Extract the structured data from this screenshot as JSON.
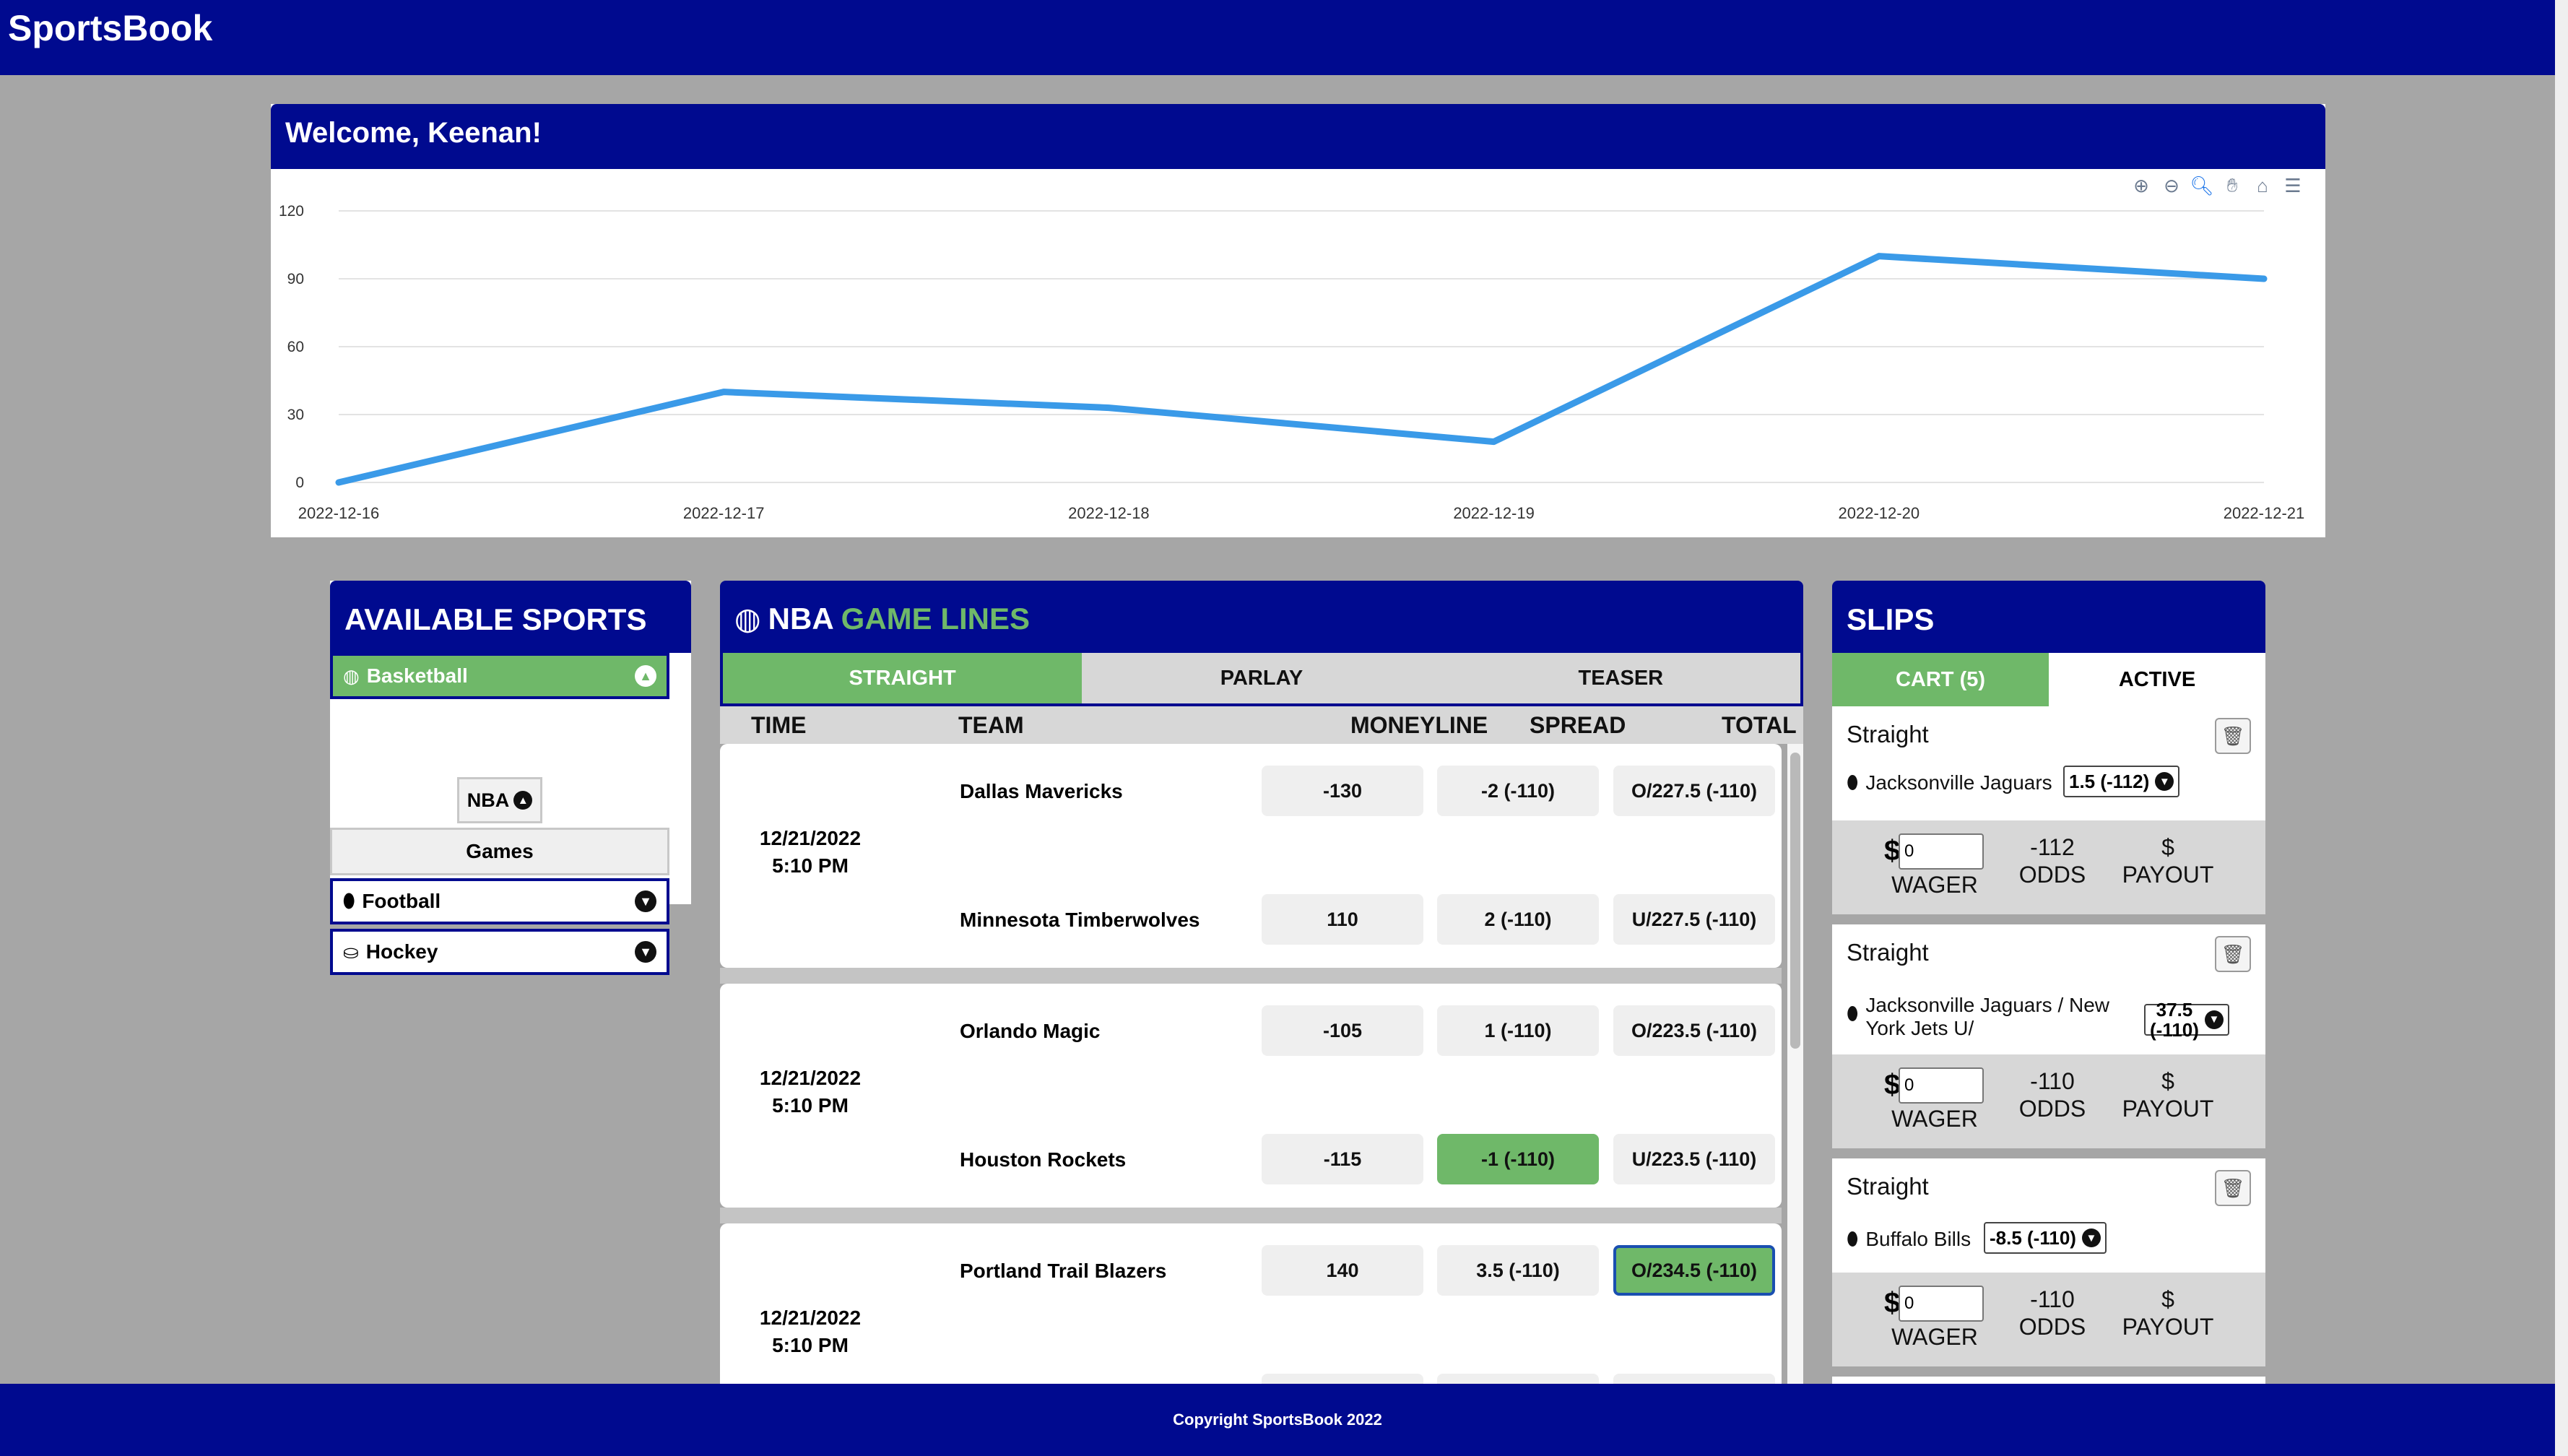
{
  "app": {
    "brand": "SportsBook"
  },
  "welcome": {
    "title": "Welcome, Keenan!"
  },
  "chart_toolbar": [
    "zoom-in-icon",
    "zoom-out-icon",
    "zoom-select-icon",
    "pan-icon",
    "reset-icon",
    "menu-icon"
  ],
  "chart_data": {
    "type": "line",
    "x": [
      "2022-12-16",
      "2022-12-17",
      "2022-12-18",
      "2022-12-19",
      "2022-12-20",
      "2022-12-21"
    ],
    "y_ticks": [
      0,
      30,
      60,
      90,
      120
    ],
    "ylim": [
      0,
      120
    ],
    "series": [
      {
        "values": [
          0,
          40,
          33,
          18,
          100,
          90
        ]
      }
    ],
    "line_color": "#3a9ae8",
    "grid": true
  },
  "sports": {
    "title": "AVAILABLE SPORTS",
    "items": [
      {
        "label": "Basketball",
        "icon": "basketball-icon",
        "expanded": true
      },
      {
        "label": "Football",
        "icon": "football-icon",
        "expanded": false
      },
      {
        "label": "Hockey",
        "icon": "hockey-puck-icon",
        "expanded": false
      }
    ],
    "league": "NBA",
    "games_label": "Games"
  },
  "lines": {
    "title_prefix": "NBA",
    "title_suffix": "GAME LINES",
    "tabs": [
      "STRAIGHT",
      "PARLAY",
      "TEASER"
    ],
    "columns": [
      "TIME",
      "TEAM",
      "MONEYLINE",
      "SPREAD",
      "TOTAL"
    ],
    "games": [
      {
        "date": "12/21/2022",
        "time": "5:10 PM",
        "home": {
          "team": "Dallas Mavericks",
          "moneyline": "-130",
          "spread": "-2 (-110)",
          "total": "O/227.5 (-110)"
        },
        "away": {
          "team": "Minnesota Timberwolves",
          "moneyline": "110",
          "spread": "2 (-110)",
          "total": "U/227.5 (-110)"
        }
      },
      {
        "date": "12/21/2022",
        "time": "5:10 PM",
        "home": {
          "team": "Orlando Magic",
          "moneyline": "-105",
          "spread": "1 (-110)",
          "total": "O/223.5 (-110)"
        },
        "away": {
          "team": "Houston Rockets",
          "moneyline": "-115",
          "spread": "-1 (-110)",
          "total": "U/223.5 (-110)"
        }
      },
      {
        "date": "12/21/2022",
        "time": "5:10 PM",
        "home": {
          "team": "Portland Trail Blazers",
          "moneyline": "140",
          "spread": "3.5 (-110)",
          "total": "O/234.5 (-110)"
        }
      }
    ]
  },
  "slips": {
    "title": "SLIPS",
    "tabs": [
      "CART (5)",
      "ACTIVE"
    ],
    "items": [
      {
        "type": "Straight",
        "pick": "Jacksonville Jaguars",
        "line": "1.5 (-112)",
        "wager": "0",
        "odds": "-112",
        "odds_label": "ODDS",
        "wager_label": "WAGER",
        "payout_symbol": "$",
        "payout_label": "PAYOUT"
      },
      {
        "type": "Straight",
        "pick_line1": "Jacksonville Jaguars / New",
        "pick_line2": "York Jets U/",
        "line1": "37.5",
        "line2": "(-110)",
        "wager": "0",
        "odds": "-110",
        "odds_label": "ODDS",
        "wager_label": "WAGER",
        "payout_symbol": "$",
        "payout_label": "PAYOUT"
      },
      {
        "type": "Straight",
        "pick": "Buffalo Bills",
        "line": "-8.5 (-110)",
        "wager": "0",
        "odds": "-110",
        "odds_label": "ODDS",
        "wager_label": "WAGER",
        "payout_symbol": "$",
        "payout_label": "PAYOUT"
      }
    ]
  },
  "footer": {
    "text": "Copyright SportsBook 2022"
  }
}
